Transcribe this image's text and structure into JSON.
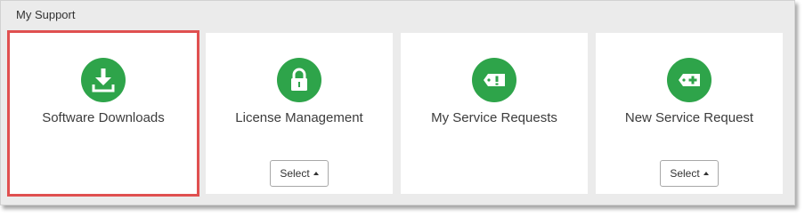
{
  "panel": {
    "title": "My Support"
  },
  "tiles": [
    {
      "label": "Software Downloads",
      "icon": "download-icon",
      "highlighted": true
    },
    {
      "label": "License Management",
      "icon": "lock-icon",
      "select_label": "Select"
    },
    {
      "label": "My Service Requests",
      "icon": "ticket-alert-icon"
    },
    {
      "label": "New Service Request",
      "icon": "ticket-add-icon",
      "select_label": "Select"
    }
  ],
  "colors": {
    "icon_green": "#2ea44a",
    "highlight_red": "#e05050",
    "panel_bg": "#ebebeb"
  }
}
